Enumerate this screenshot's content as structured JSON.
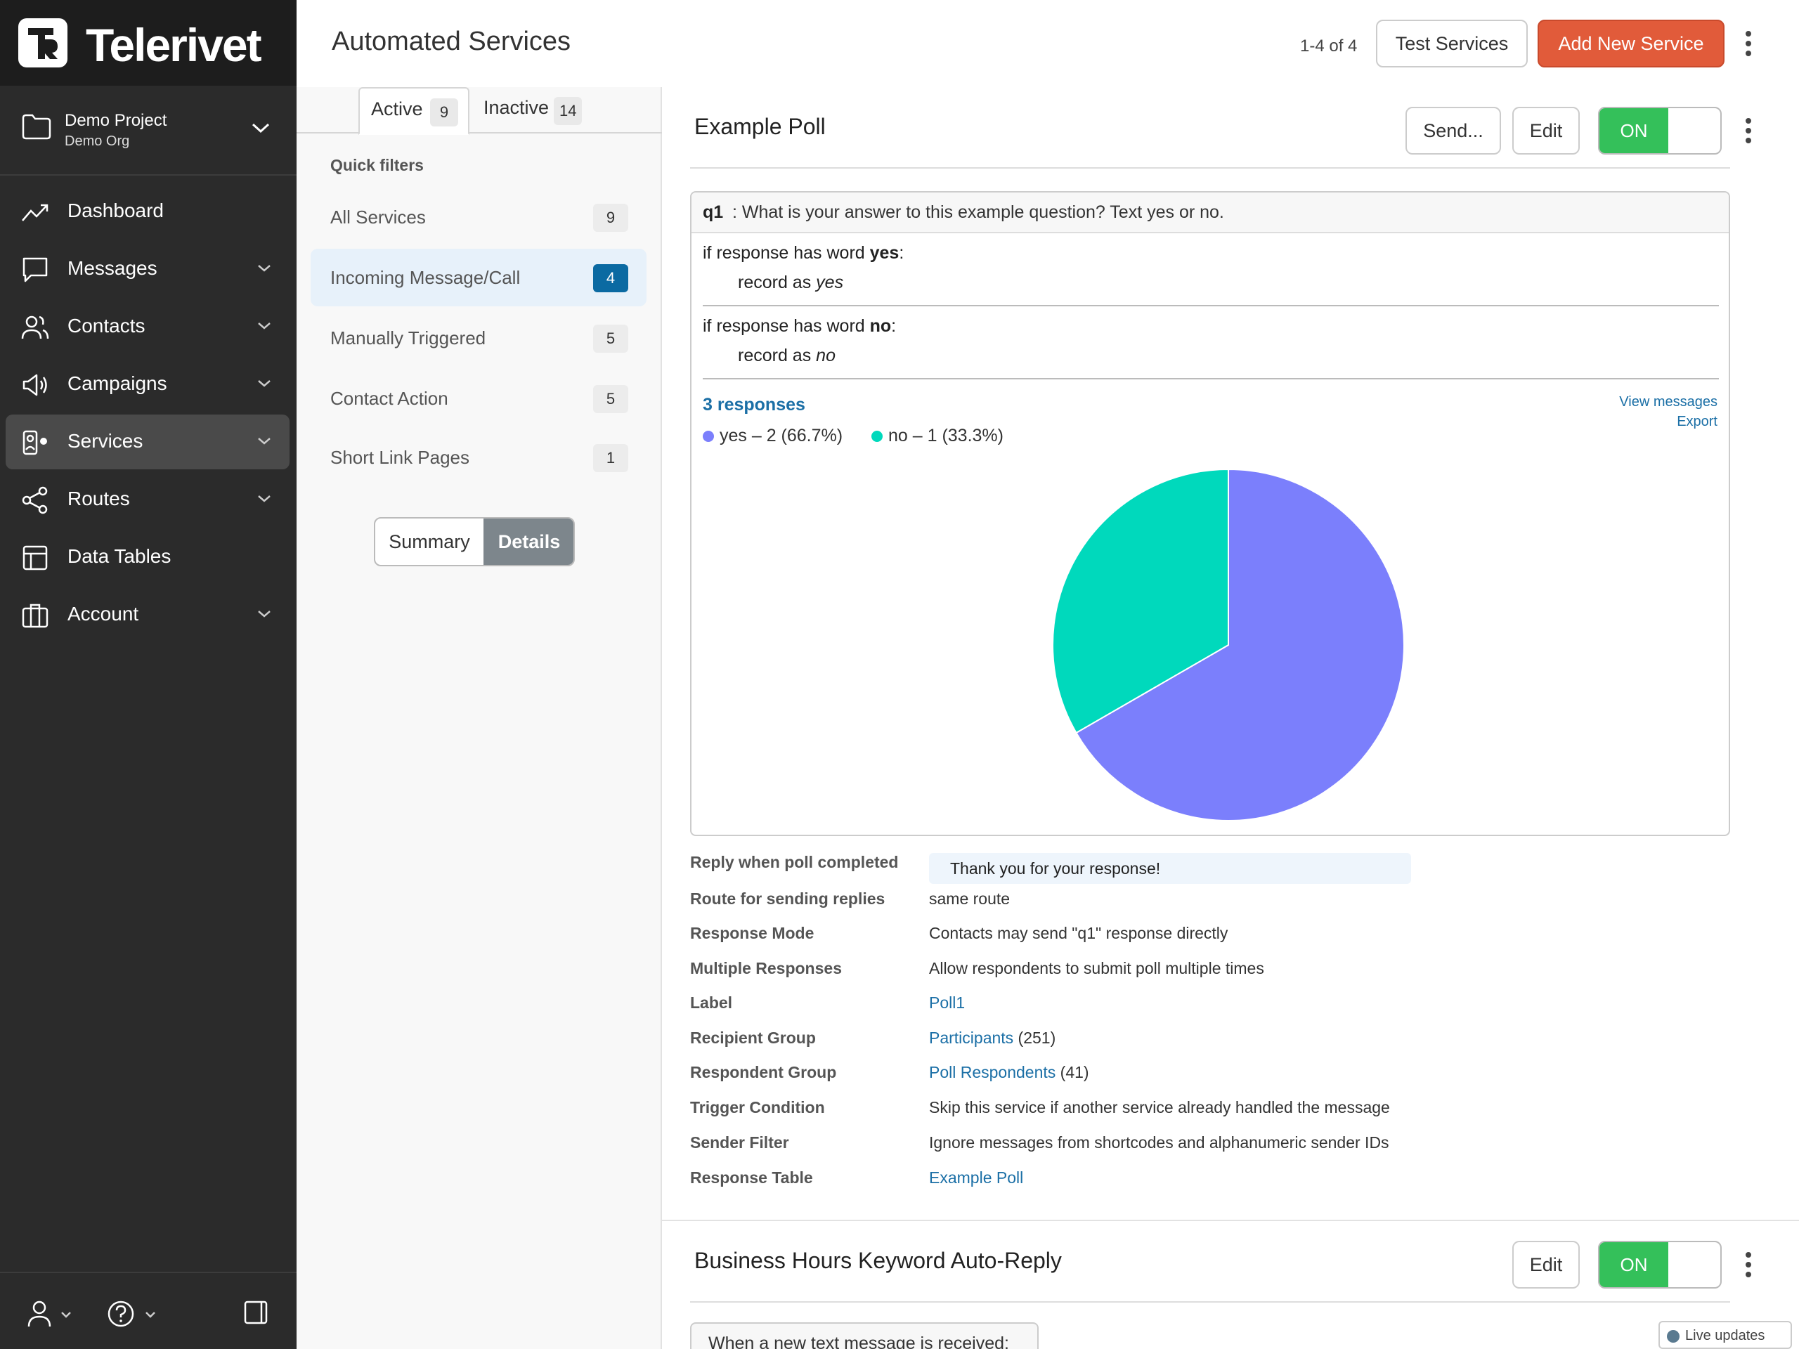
{
  "app": {
    "brand_name": "Telerivet",
    "project_name": "Demo Project",
    "org_name": "Demo Org"
  },
  "sidebar": {
    "items": [
      {
        "label": "Dashboard",
        "icon": "trend-chart-icon",
        "has_chevron": false
      },
      {
        "label": "Messages",
        "icon": "chat-bubble-icon",
        "has_chevron": true
      },
      {
        "label": "Contacts",
        "icon": "people-icon",
        "has_chevron": true
      },
      {
        "label": "Campaigns",
        "icon": "megaphone-icon",
        "has_chevron": true
      },
      {
        "label": "Services",
        "icon": "services-robot-icon",
        "has_chevron": true,
        "active": true
      },
      {
        "label": "Routes",
        "icon": "share-nodes-icon",
        "has_chevron": true
      },
      {
        "label": "Data Tables",
        "icon": "table-grid-icon",
        "has_chevron": false
      },
      {
        "label": "Account",
        "icon": "briefcase-icon",
        "has_chevron": true
      }
    ]
  },
  "header": {
    "title": "Automated Services",
    "pagination": "1-4 of 4",
    "test_services_label": "Test Services",
    "add_new_service_label": "Add New Service"
  },
  "status_tabs": [
    {
      "label": "Active",
      "count": "9",
      "active": true
    },
    {
      "label": "Inactive",
      "count": "14",
      "active": false
    }
  ],
  "quick_filters": {
    "title": "Quick filters",
    "items": [
      {
        "label": "All Services",
        "count": "9"
      },
      {
        "label": "Incoming Message/Call",
        "count": "4",
        "active": true
      },
      {
        "label": "Manually Triggered",
        "count": "5"
      },
      {
        "label": "Contact Action",
        "count": "5"
      },
      {
        "label": "Short Link Pages",
        "count": "1"
      }
    ]
  },
  "view_toggle": {
    "summary_label": "Summary",
    "details_label": "Details",
    "selected": "Details"
  },
  "service1": {
    "title": "Example Poll",
    "send_label": "Send...",
    "edit_label": "Edit",
    "toggle_label": "ON",
    "question": {
      "id": "q1",
      "text": ": What is your answer to this example question? Text yes or no."
    },
    "rules": [
      {
        "prefix": "if response has word ",
        "word": "yes",
        "suffix": ":",
        "record_prefix": "record as ",
        "record_value": "yes"
      },
      {
        "prefix": "if response has word ",
        "word": "no",
        "suffix": ":",
        "record_prefix": "record as ",
        "record_value": "no"
      }
    ],
    "responses_label": "3 responses",
    "view_messages_label": "View messages",
    "export_label": "Export",
    "legend": [
      {
        "label": "yes – 2 (66.7%)",
        "color": "#7b7ffc"
      },
      {
        "label": "no – 1 (33.3%)",
        "color": "#00d9bc"
      }
    ],
    "details": {
      "reply_when_completed": {
        "key": "Reply when poll completed",
        "value": "Thank you for your response!"
      },
      "route": {
        "key": "Route for sending replies",
        "value": "same route"
      },
      "response_mode": {
        "key": "Response Mode",
        "value": "Contacts may send \"q1\" response directly"
      },
      "multiple_responses": {
        "key": "Multiple Responses",
        "value": "Allow respondents to submit poll multiple times"
      },
      "label": {
        "key": "Label",
        "value": "Poll1"
      },
      "recipient_group": {
        "key": "Recipient Group",
        "link": "Participants",
        "count": " (251)"
      },
      "respondent_group": {
        "key": "Respondent Group",
        "link": "Poll Respondents",
        "count": " (41)"
      },
      "trigger_condition": {
        "key": "Trigger Condition",
        "value": "Skip this service if another service already handled the message"
      },
      "sender_filter": {
        "key": "Sender Filter",
        "value": "Ignore messages from shortcodes and alphanumeric sender IDs"
      },
      "response_table": {
        "key": "Response Table",
        "value": "Example Poll"
      }
    }
  },
  "service2": {
    "title": "Business Hours Keyword Auto-Reply",
    "edit_label": "Edit",
    "toggle_label": "ON",
    "trigger_text": "When a new text message is received:"
  },
  "live_updates_label": "Live updates",
  "chart_data": {
    "type": "pie",
    "categories": [
      "yes",
      "no"
    ],
    "values": [
      2,
      1
    ],
    "colors": [
      "#7b7ffc",
      "#00d9bc"
    ],
    "title": "",
    "legend_position": "top-left"
  }
}
